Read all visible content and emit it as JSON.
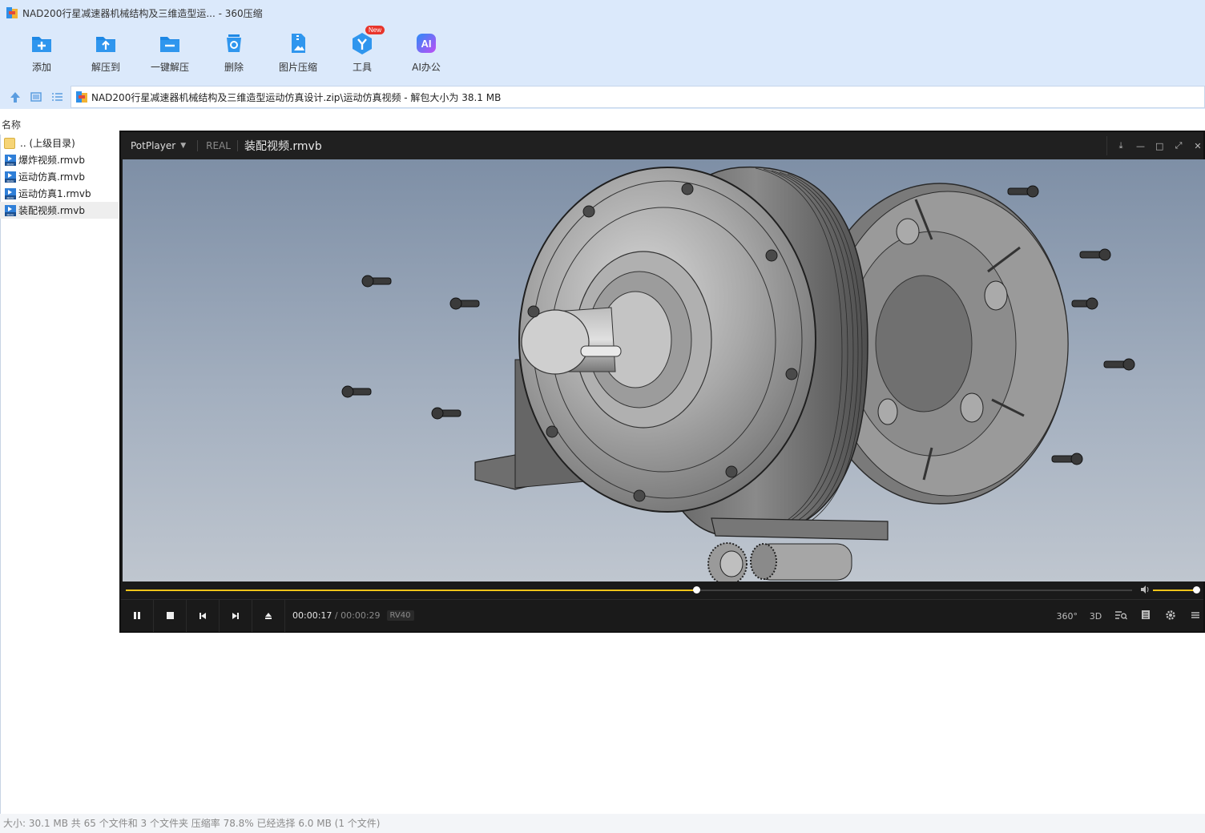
{
  "window": {
    "title": "NAD200行星减速器机械结构及三维造型运... - 360压缩"
  },
  "toolbar": {
    "items": [
      {
        "label": "添加",
        "icon": "add-file-icon"
      },
      {
        "label": "解压到",
        "icon": "extract-to-icon"
      },
      {
        "label": "一键解压",
        "icon": "one-click-extract-icon"
      },
      {
        "label": "删除",
        "icon": "delete-icon"
      },
      {
        "label": "图片压缩",
        "icon": "image-compress-icon"
      },
      {
        "label": "工具",
        "icon": "tools-icon",
        "badge": "New"
      },
      {
        "label": "AI办公",
        "icon": "ai-office-icon"
      }
    ],
    "accent": "#1e88e5"
  },
  "address": {
    "path": "NAD200行星减速器机械结构及三维造型运动仿真设计.zip\\运动仿真视频 - 解包大小为 38.1 MB"
  },
  "list": {
    "header_name": "名称",
    "rows": [
      {
        "name": ".. (上级目录)",
        "type": "folder"
      },
      {
        "name": "爆炸视频.rmvb",
        "type": "rmvb"
      },
      {
        "name": "运动仿真.rmvb",
        "type": "rmvb"
      },
      {
        "name": "运动仿真1.rmvb",
        "type": "rmvb"
      },
      {
        "name": "装配视频.rmvb",
        "type": "rmvb",
        "selected": true
      }
    ]
  },
  "player": {
    "brand": "PotPlayer",
    "format": "REAL",
    "file": "装配视频.rmvb",
    "time_current": "00:00:17",
    "time_separator": "/",
    "time_total": "00:00:29",
    "codec": "RV40",
    "progress": 0.567,
    "volume": 1.0,
    "right_controls": [
      "360°",
      "3D"
    ],
    "accent": "#f0c419"
  },
  "status": {
    "text": "大小: 30.1 MB 共 65 个文件和 3 个文件夹 压缩率 78.8% 已经选择 6.0 MB (1 个文件)"
  }
}
